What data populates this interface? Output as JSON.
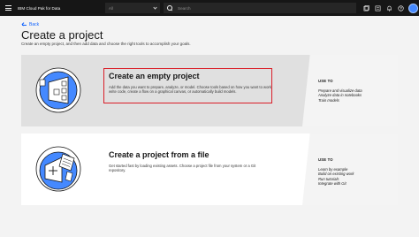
{
  "topbar": {
    "product_name": "IBM Cloud Pak for Data",
    "scope_value": "All",
    "search_placeholder": "Search"
  },
  "back_label": "Back",
  "page": {
    "title": "Create a project",
    "subtitle": "Create an empty project, and then add data and choose the right tools to accomplish your goals."
  },
  "tiles": [
    {
      "title": "Create an empty project",
      "description": "Add the data you want to prepare, analyze, or model. Choose tools based on how you want to work: write code, create a flow on a graphical canvas, or automatically build models.",
      "use_to_heading": "USE TO",
      "use_to_items": [
        "Prepare and visualize data",
        "Analyze data in notebooks",
        "Train models"
      ]
    },
    {
      "title": "Create a project from a file",
      "description": "Get started fast by loading existing assets. Choose a project file from your system or a Git repository.",
      "use_to_heading": "USE TO",
      "use_to_items": [
        "Learn by example",
        "Build on existing work",
        "Run tutorials",
        "Integrate with Git"
      ]
    }
  ],
  "colors": {
    "header_bg": "#161616",
    "link_blue": "#0f62fe",
    "highlight_red": "#da1e28",
    "illustration_blue": "#4589ff"
  },
  "icons": [
    "menu-icon",
    "chevron-down-icon",
    "search-icon",
    "catalog-icon",
    "notification-icon",
    "help-icon",
    "user-avatar",
    "arrow-left-icon"
  ]
}
